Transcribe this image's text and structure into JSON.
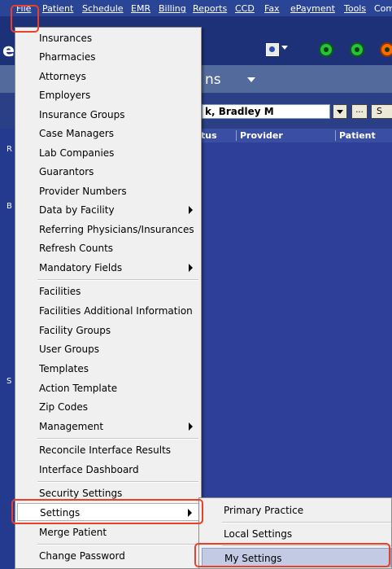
{
  "menubar": {
    "items": [
      "File",
      "Patient",
      "Schedule",
      "EMR",
      "Billing",
      "Reports",
      "CCD",
      "Fax",
      "ePayment",
      "Tools",
      "Com"
    ]
  },
  "app": {
    "tab_title": "ns",
    "patient_value": "k, Bradley M",
    "ellipsis_label": "...",
    "s_button_label": "S",
    "grid_columns": [
      "tus",
      "Provider",
      "Patient"
    ],
    "side_letters": [
      "R",
      "B",
      "S"
    ],
    "logo_fragment": "e"
  },
  "file_menu": {
    "items": [
      {
        "label": "Insurances",
        "submenu": false
      },
      {
        "label": "Pharmacies",
        "submenu": false
      },
      {
        "label": "Attorneys",
        "submenu": false
      },
      {
        "label": "Employers",
        "submenu": false
      },
      {
        "label": "Insurance Groups",
        "submenu": false
      },
      {
        "label": "Case Managers",
        "submenu": false
      },
      {
        "label": "Lab Companies",
        "submenu": false
      },
      {
        "label": "Guarantors",
        "submenu": false
      },
      {
        "label": "Provider Numbers",
        "submenu": false
      },
      {
        "label": "Data by Facility",
        "submenu": true
      },
      {
        "label": "Referring Physicians/Insurances",
        "submenu": false
      },
      {
        "label": "Refresh Counts",
        "submenu": false
      },
      {
        "label": "Mandatory Fields",
        "submenu": true
      },
      {
        "label": "Facilities",
        "submenu": false
      },
      {
        "label": "Facilities Additional Information",
        "submenu": false
      },
      {
        "label": "Facility Groups",
        "submenu": false
      },
      {
        "label": "User Groups",
        "submenu": false
      },
      {
        "label": "Templates",
        "submenu": false
      },
      {
        "label": "Action Template",
        "submenu": false
      },
      {
        "label": "Zip Codes",
        "submenu": false
      },
      {
        "label": "Management",
        "submenu": true
      },
      {
        "label": "Reconcile Interface Results",
        "submenu": false
      },
      {
        "label": "Interface Dashboard",
        "submenu": false
      },
      {
        "label": "Security Settings",
        "submenu": false
      },
      {
        "label": "Settings",
        "submenu": true
      },
      {
        "label": "Merge Patient",
        "submenu": false
      },
      {
        "label": "Change Password",
        "submenu": false
      }
    ]
  },
  "settings_submenu": {
    "items": [
      "Primary Practice",
      "Local Settings",
      "My Settings"
    ]
  },
  "colors": {
    "highlight_outline": "#e8402a",
    "status_green": "#27c13a",
    "status_orange": "#ff6a00"
  },
  "icons": [
    "user-search-icon",
    "status-dot-icon"
  ]
}
